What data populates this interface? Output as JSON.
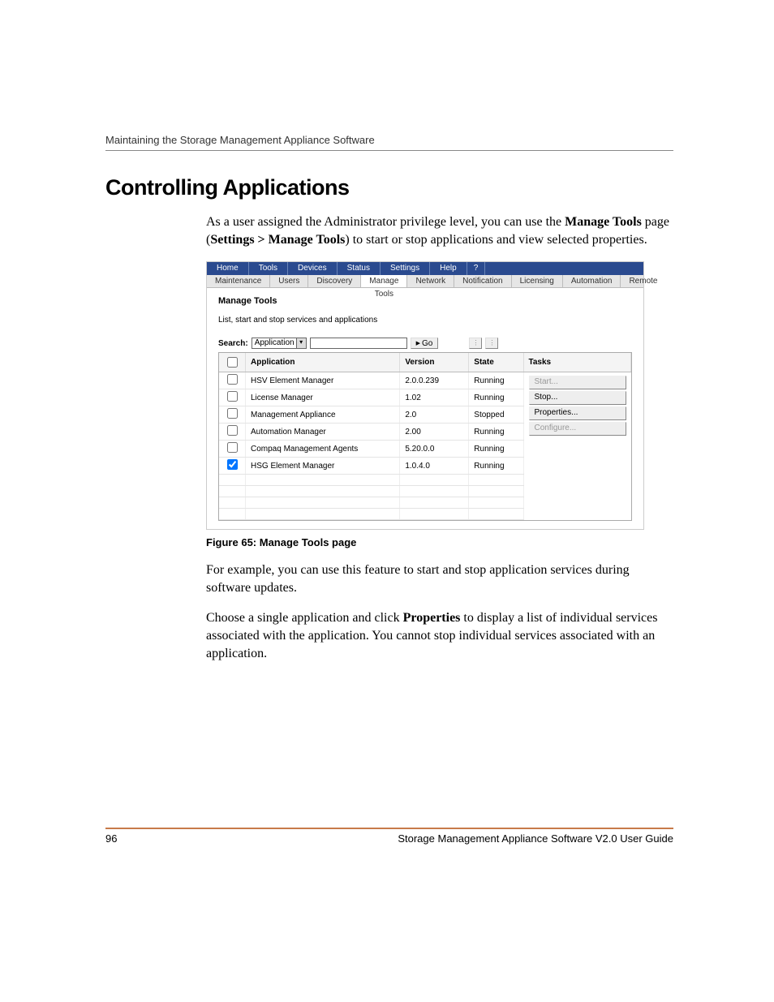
{
  "header": {
    "section": "Maintaining the Storage Management Appliance Software"
  },
  "title": "Controlling Applications",
  "intro": {
    "p1a": "As a user assigned the Administrator privilege level, you can use the ",
    "p1b": "Manage Tools",
    "p1c": " page (",
    "p1d": "Settings > Manage Tools",
    "p1e": ") to start or stop applications and view selected properties."
  },
  "screenshot": {
    "menubar": [
      "Home",
      "Tools",
      "Devices",
      "Status",
      "Settings",
      "Help",
      "?"
    ],
    "submenu": [
      "Maintenance",
      "Users",
      "Discovery",
      "Manage Tools",
      "Network",
      "Notification",
      "Licensing",
      "Automation",
      "Remote"
    ],
    "panel_title": "Manage Tools",
    "panel_desc": "List, start and stop services and applications",
    "search_label": "Search:",
    "search_select": "Application",
    "go_label": "Go",
    "columns": {
      "chk": "",
      "app": "Application",
      "ver": "Version",
      "state": "State",
      "tasks": "Tasks"
    },
    "rows": [
      {
        "checked": false,
        "app": "HSV Element Manager",
        "ver": "2.0.0.239",
        "state": "Running"
      },
      {
        "checked": false,
        "app": "License Manager",
        "ver": "1.02",
        "state": "Running"
      },
      {
        "checked": false,
        "app": "Management Appliance",
        "ver": "2.0",
        "state": "Stopped"
      },
      {
        "checked": false,
        "app": "Automation Manager",
        "ver": "2.00",
        "state": "Running"
      },
      {
        "checked": false,
        "app": "Compaq Management Agents",
        "ver": "5.20.0.0",
        "state": "Running"
      },
      {
        "checked": true,
        "app": "HSG Element Manager",
        "ver": "1.0.4.0",
        "state": "Running"
      }
    ],
    "tasks": [
      {
        "label": "Start...",
        "disabled": true
      },
      {
        "label": "Stop...",
        "disabled": false
      },
      {
        "label": "Properties...",
        "disabled": false
      },
      {
        "label": "Configure...",
        "disabled": true
      }
    ]
  },
  "figure_caption": "Figure 65:  Manage Tools page",
  "body2": "For example, you can use this feature to start and stop application services during software updates.",
  "body3": {
    "a": "Choose a single application and click ",
    "b": "Properties",
    "c": " to display a list of individual services associated with the application. You cannot stop individual services associated with an application."
  },
  "footer": {
    "page": "96",
    "doc": "Storage Management Appliance Software V2.0 User Guide"
  }
}
